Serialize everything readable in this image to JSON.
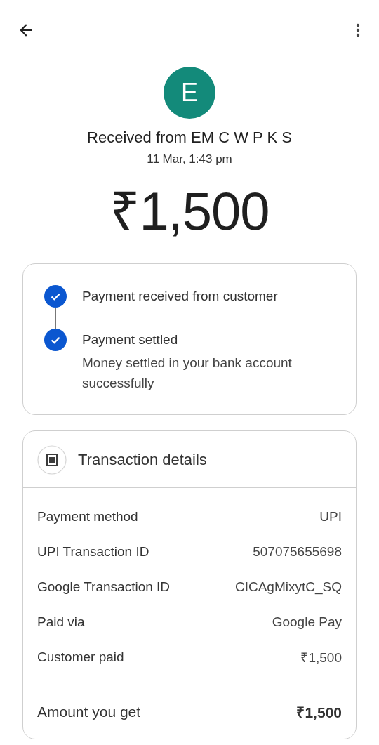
{
  "header": {
    "avatar_letter": "E",
    "title": "Received from EM C W P K S",
    "date": "11 Mar, 1:43 pm",
    "amount": "₹1,500"
  },
  "steps": [
    {
      "title": "Payment received from customer",
      "done": true
    },
    {
      "title": "Payment settled",
      "description": "Money settled in your bank account successfully",
      "done": true
    }
  ],
  "details": {
    "title": "Transaction details",
    "rows": [
      {
        "label": "Payment method",
        "value": "UPI"
      },
      {
        "label": "UPI Transaction ID",
        "value": "507075655698"
      },
      {
        "label": "Google Transaction ID",
        "value": "CICAgMixytC_SQ"
      },
      {
        "label": "Paid via",
        "value": "Google Pay"
      },
      {
        "label": "Customer paid",
        "value": "₹1,500"
      }
    ],
    "total": {
      "label": "Amount you get",
      "value": "₹1,500"
    }
  }
}
